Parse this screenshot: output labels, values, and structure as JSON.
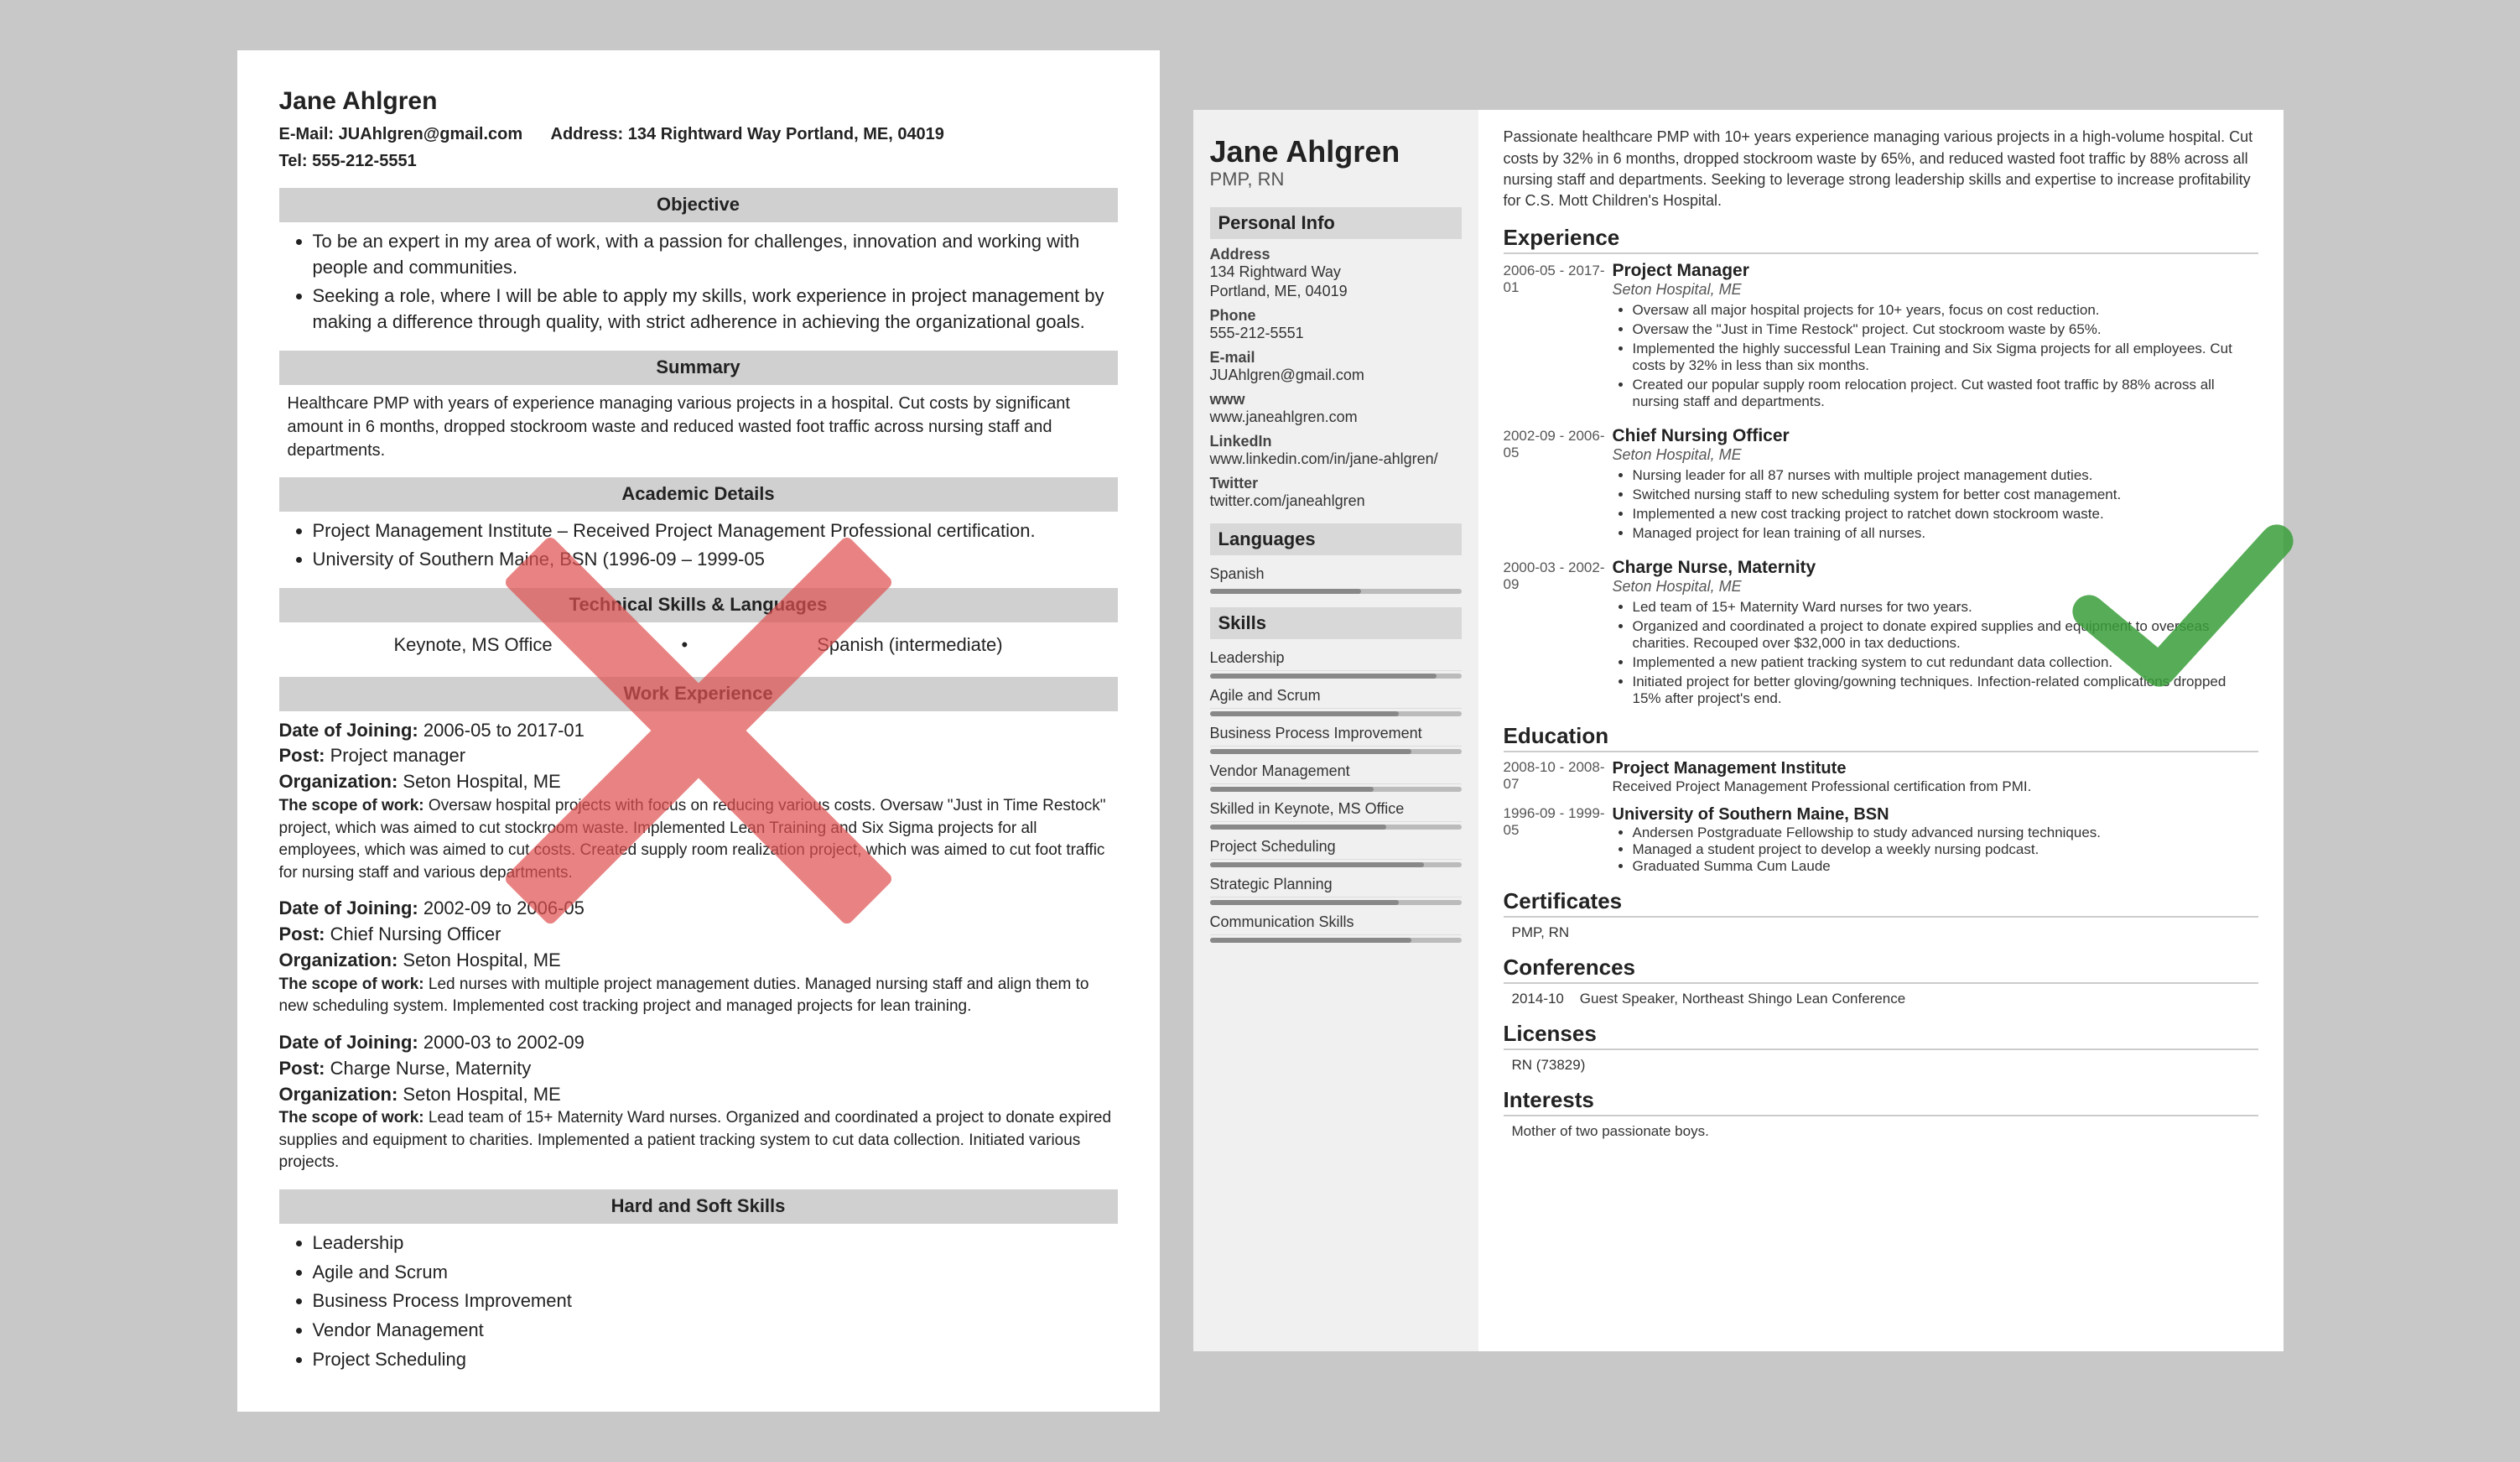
{
  "left_resume": {
    "name": "Jane Ahlgren",
    "email_label": "E-Mail:",
    "email": "JUAhlgren@gmail.com",
    "address_label": "Address:",
    "address": "134 Rightward Way Portland, ME, 04019",
    "tel_label": "Tel:",
    "tel": "555-212-5551",
    "sections": {
      "objective": {
        "title": "Objective",
        "bullets": [
          "To be an expert in my area of work, with a passion for challenges, innovation and working with people and communities.",
          "Seeking a role, where I will be able to apply my skills, work experience in project management by making a difference through quality, with strict adherence in achieving the organizational goals."
        ]
      },
      "summary": {
        "title": "Summary",
        "text": "Healthcare PMP with years of experience managing various projects in a hospital. Cut costs by significant amount in 6 months, dropped stockroom waste and reduced wasted foot traffic across nursing staff and departments."
      },
      "academic": {
        "title": "Academic Details",
        "bullets": [
          "Project Management Institute – Received Project Management Professional certification.",
          "University of Southern Maine, BSN (1996-09 – 1999-05"
        ]
      },
      "technical": {
        "title": "Technical Skills & Languages",
        "col1": "Keynote, MS Office",
        "col2": "Spanish (intermediate)"
      },
      "work": {
        "title": "Work Experience",
        "entries": [
          {
            "date": "Date of Joining:",
            "date_val": "2006-05 to 2017-01",
            "post_label": "Post:",
            "post": "Project manager",
            "org_label": "Organization:",
            "org": "Seton Hospital, ME",
            "scope_label": "The scope of work:",
            "scope": "Oversaw hospital projects with focus on reducing various costs. Oversaw \"Just in Time Restock\" project, which was aimed to cut stockroom waste. Implemented Lean Training and Six Sigma projects for all employees, which was aimed to cut costs. Created supply room realization project, which was aimed to cut foot traffic for nursing staff and various departments."
          },
          {
            "date": "Date of Joining:",
            "date_val": "2002-09 to 2006-05",
            "post_label": "Post:",
            "post": "Chief Nursing Officer",
            "org_label": "Organization:",
            "org": "Seton Hospital, ME",
            "scope_label": "The scope of work:",
            "scope": "Led nurses with multiple project management duties. Managed nursing staff and align them to new scheduling system. Implemented cost tracking project and managed projects for lean training."
          },
          {
            "date": "Date of Joining:",
            "date_val": "2000-03 to 2002-09",
            "post_label": "Post:",
            "post": "Charge Nurse, Maternity",
            "org_label": "Organization:",
            "org": "Seton Hospital, ME",
            "scope_label": "The scope of work:",
            "scope": "Lead team of 15+ Maternity Ward nurses. Organized and coordinated a project to donate expired supplies and equipment to charities. Implemented a patient tracking system to cut data collection. Initiated various projects."
          }
        ]
      },
      "hard_soft": {
        "title": "Hard and Soft Skills",
        "bullets": [
          "Leadership",
          "Agile and Scrum",
          "Business Process Improvement",
          "Vendor Management",
          "Project Scheduling"
        ]
      }
    }
  },
  "right_resume": {
    "name": "Jane Ahlgren",
    "title": "PMP, RN",
    "summary": "Passionate healthcare PMP with 10+ years experience managing various projects in a high-volume hospital. Cut costs by 32% in 6 months, dropped stockroom waste by 65%, and reduced wasted foot traffic by 88% across all nursing staff and departments. Seeking to leverage strong leadership skills and expertise to increase profitability for C.S. Mott Children's Hospital.",
    "sidebar": {
      "personal_info_title": "Personal Info",
      "fields": [
        {
          "label": "Address",
          "value1": "134 Rightward Way",
          "value2": "Portland, ME, 04019"
        },
        {
          "label": "Phone",
          "value1": "555-212-5551",
          "value2": ""
        },
        {
          "label": "E-mail",
          "value1": "JUAhlgren@gmail.com",
          "value2": ""
        },
        {
          "label": "www",
          "value1": "www.janeahlgren.com",
          "value2": ""
        },
        {
          "label": "LinkedIn",
          "value1": "www.linkedin.com/in/jane-ahlgren/",
          "value2": ""
        },
        {
          "label": "Twitter",
          "value1": "twitter.com/janeahlgren",
          "value2": ""
        }
      ],
      "languages_title": "Languages",
      "languages": [
        {
          "name": "Spanish",
          "level": 60
        }
      ],
      "skills_title": "Skills",
      "skills": [
        {
          "name": "Leadership",
          "level": 90
        },
        {
          "name": "Agile and Scrum",
          "level": 75
        },
        {
          "name": "Business Process Improvement",
          "level": 80
        },
        {
          "name": "Vendor Management",
          "level": 65
        },
        {
          "name": "Skilled in Keynote, MS Office",
          "level": 70
        },
        {
          "name": "Project Scheduling",
          "level": 85
        },
        {
          "name": "Strategic Planning",
          "level": 75
        },
        {
          "name": "Communication Skills",
          "level": 80
        }
      ]
    },
    "experience_title": "Experience",
    "experience": [
      {
        "dates": "2006-05 - 2017-01",
        "title": "Project Manager",
        "org": "Seton Hospital, ME",
        "bullets": [
          "Oversaw all major hospital projects for 10+ years, focus on cost reduction.",
          "Oversaw the \"Just in Time Restock\" project. Cut stockroom waste by 65%.",
          "Implemented the highly successful Lean Training and Six Sigma projects for all employees. Cut costs by 32% in less than six months.",
          "Created our popular supply room relocation project. Cut wasted foot traffic by 88% across all nursing staff and departments."
        ]
      },
      {
        "dates": "2002-09 - 2006-05",
        "title": "Chief Nursing Officer",
        "org": "Seton Hospital, ME",
        "bullets": [
          "Nursing leader for all 87 nurses with multiple project management duties.",
          "Switched nursing staff to new scheduling system for better cost management.",
          "Implemented a new cost tracking project to ratchet down stockroom waste.",
          "Managed project for lean training of all nurses."
        ]
      },
      {
        "dates": "2000-03 - 2002-09",
        "title": "Charge Nurse, Maternity",
        "org": "Seton Hospital, ME",
        "bullets": [
          "Led team of 15+ Maternity Ward nurses for two years.",
          "Organized and coordinated a project to donate expired supplies and equipment to overseas charities. Recouped over $32,000 in tax deductions.",
          "Implemented a new patient tracking system to cut redundant data collection.",
          "Initiated project for better gloving/gowning techniques. Infection-related complications dropped 15% after project's end."
        ]
      }
    ],
    "education_title": "Education",
    "education": [
      {
        "dates": "2008-10 - 2008-07",
        "title": "Project Management Institute",
        "detail": "Received Project Management Professional certification from PMI.",
        "bullets": []
      },
      {
        "dates": "1996-09 - 1999-05",
        "title": "University of Southern Maine, BSN",
        "detail": "",
        "bullets": [
          "Andersen Postgraduate Fellowship to study advanced nursing techniques.",
          "Managed a student project to develop a weekly nursing podcast.",
          "Graduated Summa Cum Laude"
        ]
      }
    ],
    "certificates_title": "Certificates",
    "certificates": [
      "PMP, RN"
    ],
    "conferences_title": "Conferences",
    "conferences": [
      {
        "date": "2014-10",
        "text": "Guest Speaker, Northeast Shingo Lean Conference"
      }
    ],
    "licenses_title": "Licenses",
    "licenses": [
      "RN (73829)"
    ],
    "interests_title": "Interests",
    "interests": [
      "Mother of two passionate boys."
    ]
  }
}
